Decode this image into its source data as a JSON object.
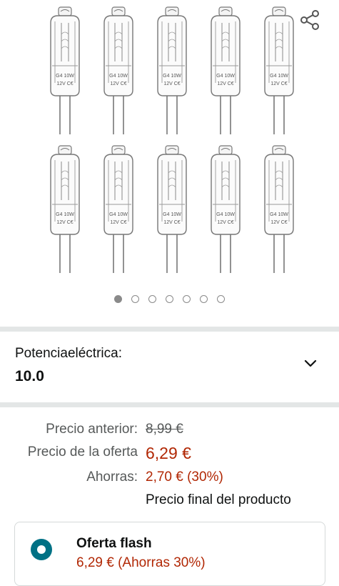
{
  "gallery": {
    "bulb_markings": {
      "line1": "G4 10W",
      "line2": "12V C€"
    },
    "image_count": 7,
    "active_index": 0,
    "share_icon": "share-icon"
  },
  "variation": {
    "label": "Potenciaeléctrica:",
    "value": "10.0",
    "chevron_icon": "chevron-down-icon"
  },
  "pricing": {
    "previous_label": "Precio anterior:",
    "previous_price": "8,99 €",
    "deal_label": "Precio de la oferta",
    "deal_price": "6,29 €",
    "savings_label": "Ahorras:",
    "savings_value": "2,70 € (30%)",
    "final_note": "Precio final del producto"
  },
  "flash_offer": {
    "title": "Oferta flash",
    "subtitle": "6,29 € (Ahorras 30%)",
    "selected": true
  },
  "colors": {
    "price_red": "#b12704",
    "teal": "#007185",
    "divider": "#e3e6e6"
  }
}
